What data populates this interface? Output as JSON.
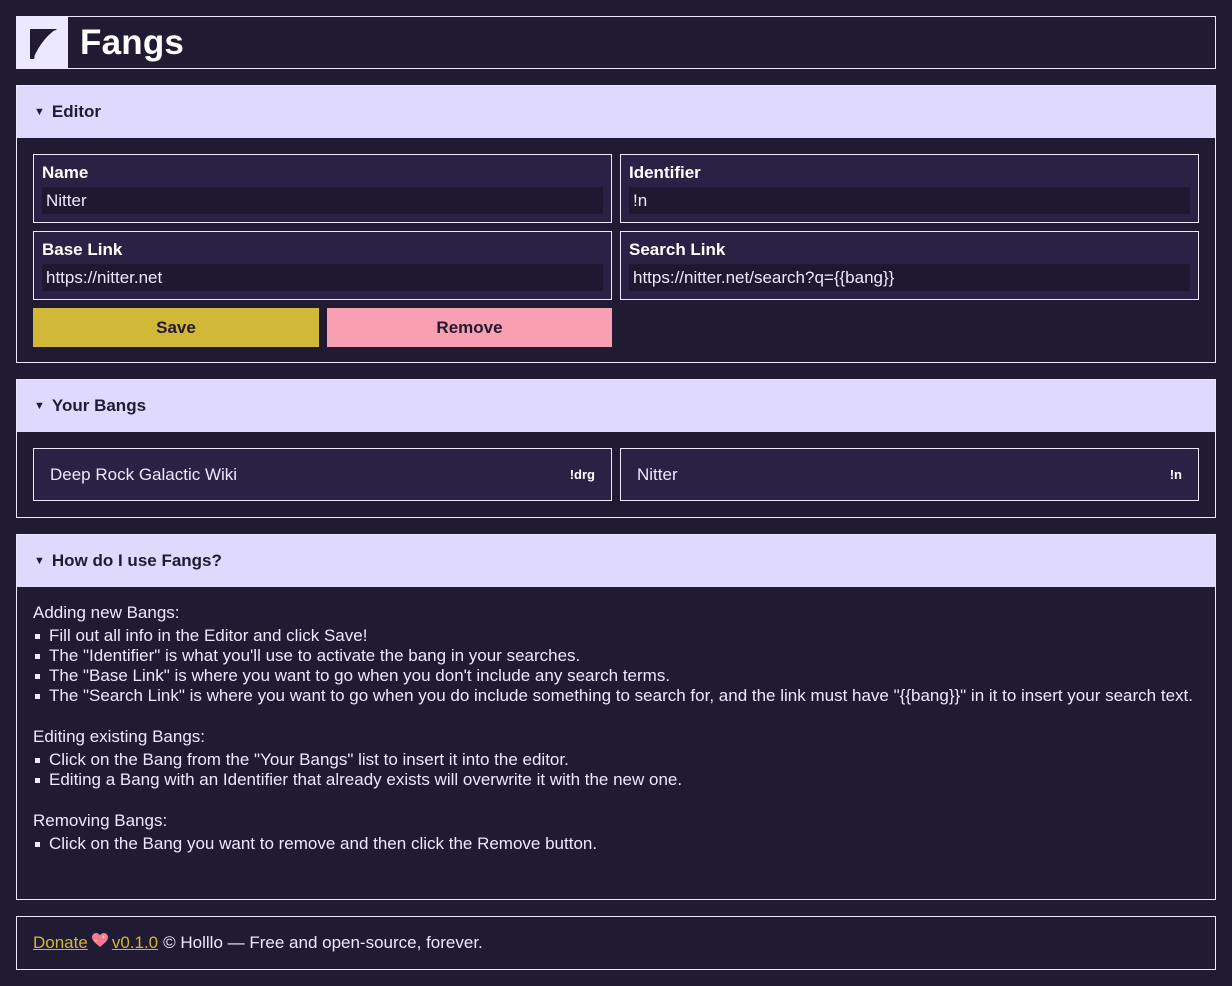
{
  "header": {
    "title": "Fangs",
    "logo_icon": "fangs-logo-icon"
  },
  "editor": {
    "title": "Editor",
    "name": {
      "label": "Name",
      "value": "Nitter"
    },
    "identifier": {
      "label": "Identifier",
      "value": "!n"
    },
    "base_link": {
      "label": "Base Link",
      "value": "https://nitter.net"
    },
    "search_link": {
      "label": "Search Link",
      "value": "https://nitter.net/search?q={{bang}}"
    },
    "save_label": "Save",
    "remove_label": "Remove"
  },
  "bangs": {
    "title": "Your Bangs",
    "items": [
      {
        "name": "Deep Rock Galactic Wiki",
        "id": "!drg"
      },
      {
        "name": "Nitter",
        "id": "!n"
      }
    ]
  },
  "help": {
    "title": "How do I use Fangs?",
    "sections": [
      {
        "title": "Adding new Bangs:",
        "items": [
          "Fill out all info in the Editor and click Save!",
          "The \"Identifier\" is what you'll use to activate the bang in your searches.",
          "The \"Base Link\" is where you want to go when you don't include any search terms.",
          "The \"Search Link\" is where you want to go when you do include something to search for, and the link must have \"{{bang}}\" in it to insert your search text."
        ]
      },
      {
        "title": "Editing existing Bangs:",
        "items": [
          "Click on the Bang from the \"Your Bangs\" list to insert it into the editor.",
          "Editing a Bang with an Identifier that already exists will overwrite it with the new one."
        ]
      },
      {
        "title": "Removing Bangs:",
        "items": [
          "Click on the Bang you want to remove and then click the Remove button."
        ]
      }
    ]
  },
  "footer": {
    "donate_label": "Donate",
    "heart_icon": "sparkling-heart-icon",
    "version_label": "v0.1.0",
    "rest_text": "© Holllo — Free and open-source, forever."
  },
  "colors": {
    "background": "#201a33",
    "foreground": "#ece8ff",
    "panel_header": "#dfdafd",
    "save": "#d1b837",
    "remove": "#f89fb1"
  }
}
